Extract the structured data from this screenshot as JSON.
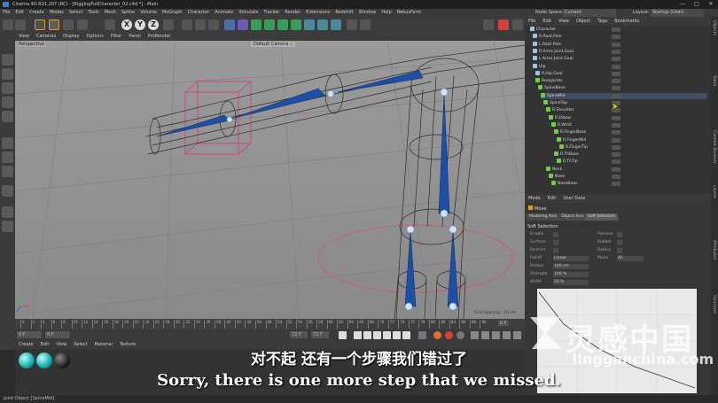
{
  "window": {
    "title": "Cinema 4D R21.207 (RC) - [RiggingFullCharacter_02.c4d *] - Main",
    "minimize": "—",
    "maximize": "□",
    "close": "✕"
  },
  "menubar": {
    "items": [
      "File",
      "Edit",
      "Create",
      "Modes",
      "Select",
      "Tools",
      "Mesh",
      "Spline",
      "Volume",
      "MoGraph",
      "Character",
      "Animate",
      "Simulate",
      "Tracker",
      "Render",
      "Extensions",
      "Redshift",
      "Window",
      "Help",
      "RebusFarm"
    ]
  },
  "right_header": {
    "node_space_label": "Node Space:",
    "node_space_value": "Current (Standard/Physical)",
    "layout_label": "Layout:",
    "layout_value": "Startup (User)"
  },
  "toolbar": {
    "axis_buttons": [
      "X",
      "Y",
      "Z"
    ]
  },
  "viewport": {
    "menu": [
      "View",
      "Cameras",
      "Display",
      "Options",
      "Filter",
      "Panel",
      "ProRender"
    ],
    "camera_label": "Perspective",
    "camera_badge": "Default Camera ∘",
    "grid_spacing": "Grid Spacing : 10 cm"
  },
  "timeline": {
    "ticks": [
      "0",
      "2",
      "4",
      "6",
      "8",
      "10",
      "12",
      "14",
      "16",
      "18",
      "20",
      "22",
      "24",
      "26",
      "28",
      "30",
      "32",
      "34",
      "36",
      "38",
      "40",
      "42",
      "44",
      "46",
      "48",
      "50",
      "52",
      "54",
      "56",
      "58",
      "60",
      "62",
      "64",
      "66",
      "68",
      "70",
      "72",
      "74",
      "76",
      "78",
      "80",
      "82",
      "84",
      "86",
      "88",
      "90"
    ],
    "end_frame": "0 F"
  },
  "transport": {
    "current_frame": "0 F",
    "start_frame": "0 F",
    "max_frame": "72 F",
    "end_frame": "72 F"
  },
  "material_manager": {
    "menu": [
      "Create",
      "Edit",
      "View",
      "Select",
      "Material",
      "Texture"
    ]
  },
  "status_bar": {
    "text": "Joint Object [SpineMid]"
  },
  "object_manager": {
    "menu": [
      "File",
      "Edit",
      "View",
      "Object",
      "Tags",
      "Bookmarks"
    ],
    "rows": [
      {
        "label": "Character",
        "indent": 0,
        "icon": "null"
      },
      {
        "label": "R.Root.Pole",
        "indent": 1,
        "icon": "null"
      },
      {
        "label": "L.Root.Pole",
        "indent": 1,
        "icon": "null"
      },
      {
        "label": "R.Arms.Joint.Goal",
        "indent": 1,
        "icon": "null"
      },
      {
        "label": "L.Arms.Joint.Goal",
        "indent": 1,
        "icon": "null"
      },
      {
        "label": "Hip",
        "indent": 1,
        "icon": "null"
      },
      {
        "label": "R.Hip.Goal",
        "indent": 2,
        "icon": "null"
      },
      {
        "label": "BodyJoints",
        "indent": 2,
        "icon": "joint"
      },
      {
        "label": "SpineBase",
        "indent": 3,
        "icon": "joint"
      },
      {
        "label": "SpineMid",
        "indent": 4,
        "icon": "joint"
      },
      {
        "label": "SpineTop",
        "indent": 5,
        "icon": "joint"
      },
      {
        "label": "R.Shoulder",
        "indent": 6,
        "icon": "joint"
      },
      {
        "label": "R.Elbow",
        "indent": 7,
        "icon": "joint"
      },
      {
        "label": "R.Wrist",
        "indent": 8,
        "icon": "joint"
      },
      {
        "label": "R.FingerBase",
        "indent": 9,
        "icon": "joint"
      },
      {
        "label": "R.FingerMid",
        "indent": 10,
        "icon": "joint"
      },
      {
        "label": "R.FingerTip",
        "indent": 11,
        "icon": "joint"
      },
      {
        "label": "R.ThBase",
        "indent": 9,
        "icon": "joint"
      },
      {
        "label": "R.ThTip",
        "indent": 10,
        "icon": "joint"
      },
      {
        "label": "Neck",
        "indent": 6,
        "icon": "joint"
      },
      {
        "label": "Nose",
        "indent": 7,
        "icon": "joint"
      },
      {
        "label": "NoseBase",
        "indent": 8,
        "icon": "joint"
      }
    ]
  },
  "attribute_manager": {
    "menu": [
      "Mode",
      "Edit",
      "User Data"
    ],
    "object_label": "Move",
    "tabs": [
      "Modeling Axis",
      "Object Axis",
      "Soft Selection"
    ],
    "section_title": "Soft Selection",
    "fields": [
      {
        "label": "Enable",
        "value": "",
        "label2": "Preview",
        "value2": ""
      },
      {
        "label": "Surface",
        "value": "",
        "label2": "Rubber",
        "value2": ""
      },
      {
        "label": "Restrict",
        "value": "",
        "label2": "Radius",
        "value2": ""
      },
      {
        "label": "Falloff",
        "value": "Linear",
        "label2": "Mode",
        "value2": "All"
      },
      {
        "label": "Radius",
        "value": "100 cm",
        "label2": "",
        "value2": ""
      },
      {
        "label": "Strength",
        "value": "100 %",
        "label2": "",
        "value2": ""
      },
      {
        "label": "Width",
        "value": "50 %",
        "label2": "",
        "value2": ""
      }
    ]
  },
  "side_tabs": [
    "Objects",
    "Takes",
    "Content Browser",
    "Layers",
    "Attributes",
    "Structure"
  ],
  "subtitles": {
    "chinese": "对不起 还有一个步骤我们错过了",
    "english": "Sorry, there is one more step that we missed."
  },
  "watermark": {
    "chinese": "灵感中国",
    "english": "lingganchina.com"
  },
  "colors": {
    "accent": "#3a7bd5",
    "joint_icon": "#6fcf4a",
    "viewport_bg": "#8f8f8f",
    "selection_pink": "#e0307f"
  }
}
